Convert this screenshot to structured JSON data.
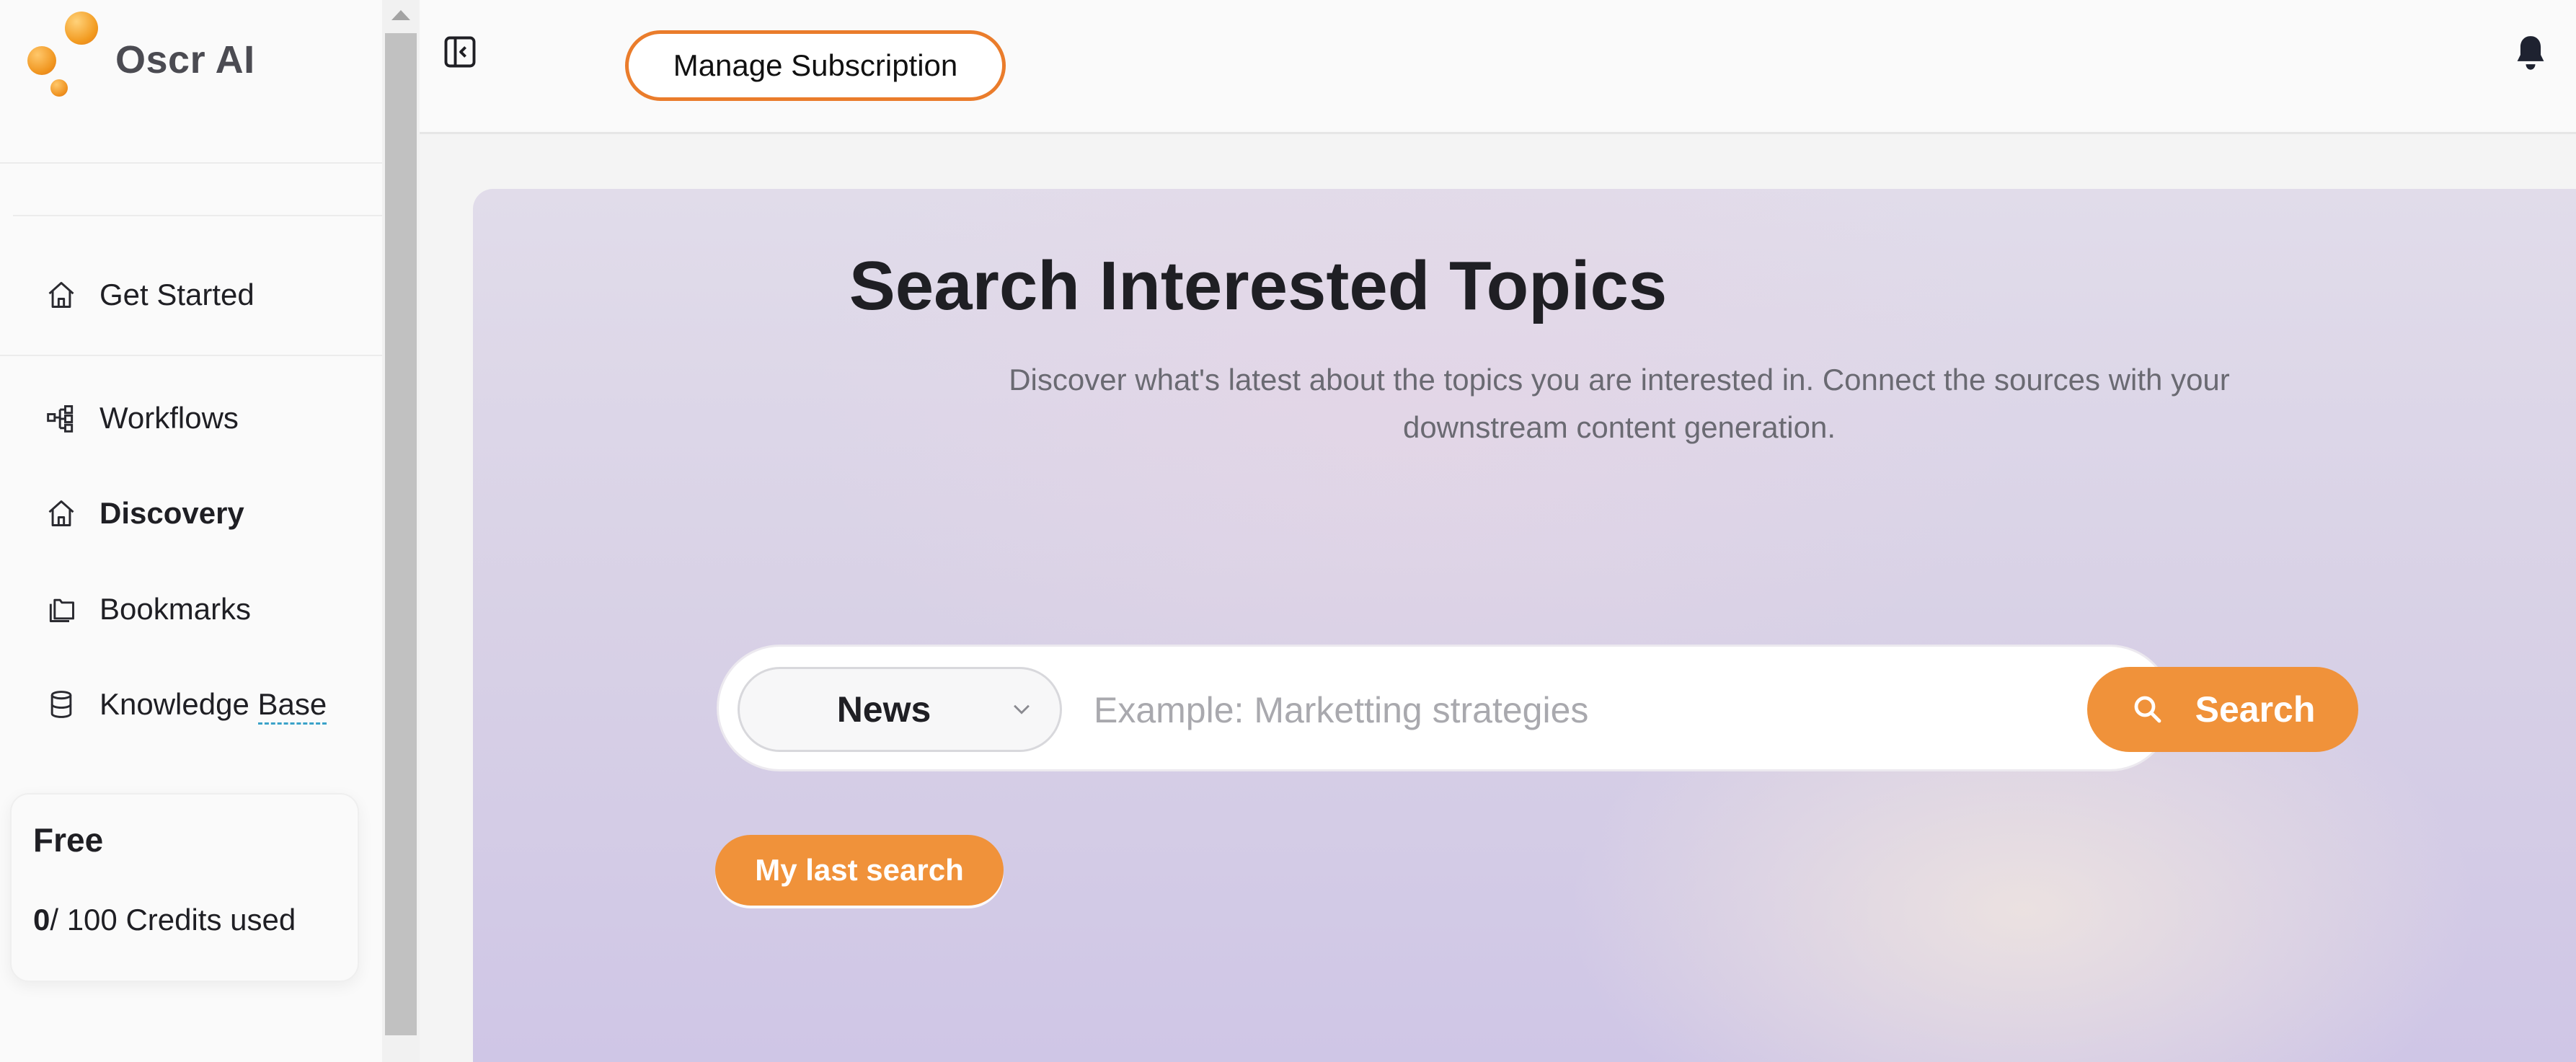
{
  "app": {
    "name": "Oscr AI"
  },
  "sidebar": {
    "items": [
      {
        "label": "Get Started",
        "icon": "home-icon"
      },
      {
        "label": "Workflows",
        "icon": "workflow-icon"
      },
      {
        "label": "Discovery",
        "icon": "home-icon",
        "active": true
      },
      {
        "label": "Bookmarks",
        "icon": "bookmarks-icon"
      },
      {
        "label": "Knowledge Base",
        "icon": "database-icon"
      }
    ],
    "knowledge_base_prefix": "Knowledge ",
    "knowledge_base_suffix": "Base",
    "plan": {
      "name": "Free",
      "credits_used": "0",
      "credits_rest": "/ 100 Credits used"
    }
  },
  "topbar": {
    "manage_label": "Manage Subscription",
    "icons": [
      "sidebar-collapse-icon",
      "bell-icon"
    ]
  },
  "hero": {
    "title": "Search Interested Topics",
    "subtitle": "Discover what's latest about the topics you are interested in. Connect the sources with your downstream content generation."
  },
  "search": {
    "category": "News",
    "placeholder": "Example: Marketting strategies",
    "value": "",
    "button_label": "Search",
    "last_search_label": "My last search"
  },
  "colors": {
    "accent": "#f0923a",
    "accent_border": "#ea7c2b",
    "link_underline": "#3aa2c9"
  }
}
